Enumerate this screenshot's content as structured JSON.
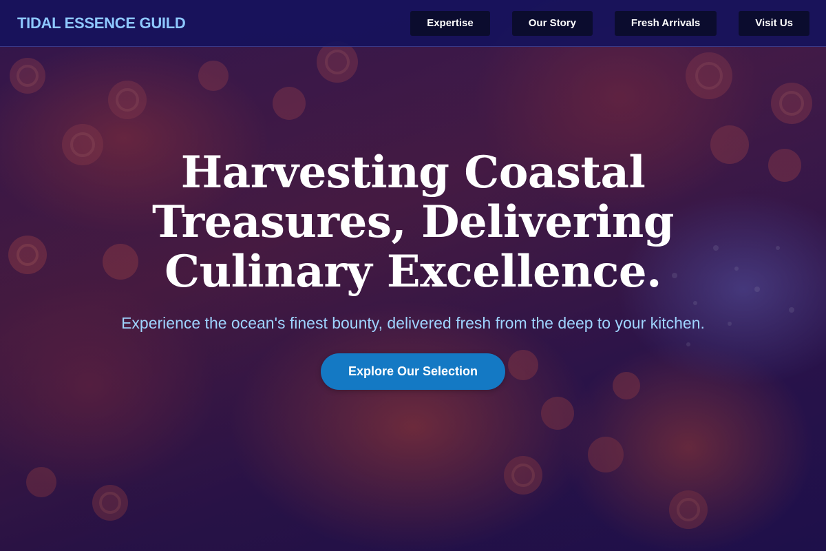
{
  "header": {
    "brand": "TIDAL ESSENCE GUILD",
    "nav": [
      {
        "label": "Expertise"
      },
      {
        "label": "Our Story"
      },
      {
        "label": "Fresh Arrivals"
      },
      {
        "label": "Visit Us"
      }
    ]
  },
  "hero": {
    "title": "Harvesting Coastal Treasures, Delivering Culinary Excellence.",
    "subtitle": "Experience the ocean's finest bounty, delivered fresh from the deep to your kitchen.",
    "cta_label": "Explore Our Selection"
  },
  "colors": {
    "nav_background": "#16125c",
    "brand_text": "#8ec8ff",
    "nav_button": "#0b0c2e",
    "subtitle_text": "#9fd4ff",
    "cta_background": "#1479c4"
  }
}
